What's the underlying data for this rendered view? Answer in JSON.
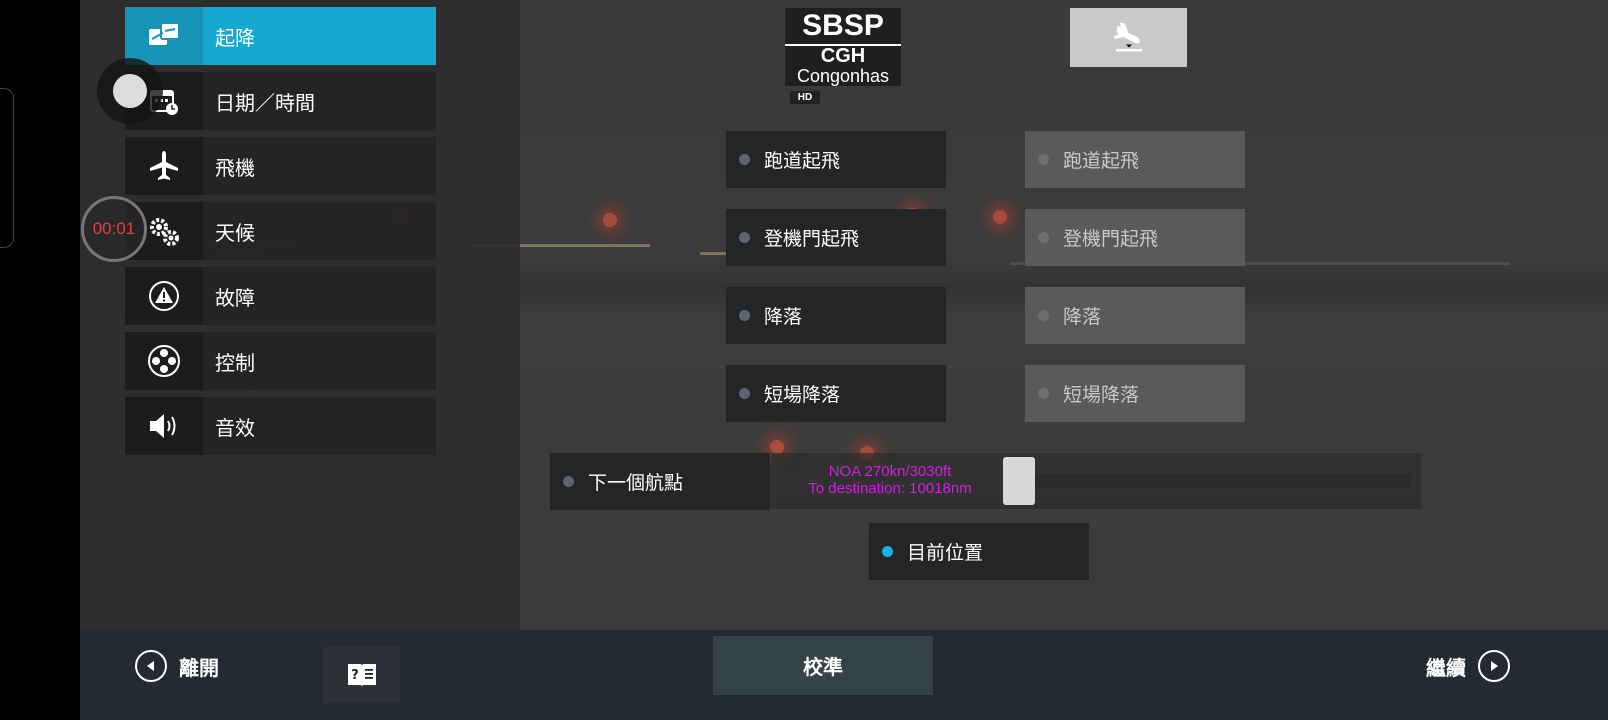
{
  "sidebar": {
    "items": [
      {
        "label": "起降",
        "icon": "takeoff-landing-icon",
        "active": true
      },
      {
        "label": "日期／時間",
        "icon": "calendar-clock-icon",
        "active": false
      },
      {
        "label": "飛機",
        "icon": "airplane-icon",
        "active": false
      },
      {
        "label": "天候",
        "icon": "weather-gear-icon",
        "active": false
      },
      {
        "label": "故障",
        "icon": "warning-icon",
        "active": false
      },
      {
        "label": "控制",
        "icon": "controls-icon",
        "active": false
      },
      {
        "label": "音效",
        "icon": "speaker-icon",
        "active": false
      }
    ]
  },
  "overlay": {
    "timer": "00:01"
  },
  "airport": {
    "icao": "SBSP",
    "iata": "CGH",
    "name": "Congonhas",
    "badge": "HD"
  },
  "options_left": [
    "跑道起飛",
    "登機門起飛",
    "降落",
    "短場降落"
  ],
  "options_right": [
    "跑道起飛",
    "登機門起飛",
    "降落",
    "短場降落"
  ],
  "waypoint": {
    "label": "下一個航點",
    "info_line1": "NOA 270kn/3030ft",
    "info_line2": "To destination: 10018nm"
  },
  "current_position": {
    "label": "目前位置",
    "selected": true
  },
  "bottom": {
    "exit_label": "離開",
    "calibrate_label": "校準",
    "continue_label": "繼續"
  },
  "colors": {
    "accent": "#16a8cf",
    "waypoint_text": "#d21ee0",
    "selected_dot": "#19b3e6"
  }
}
